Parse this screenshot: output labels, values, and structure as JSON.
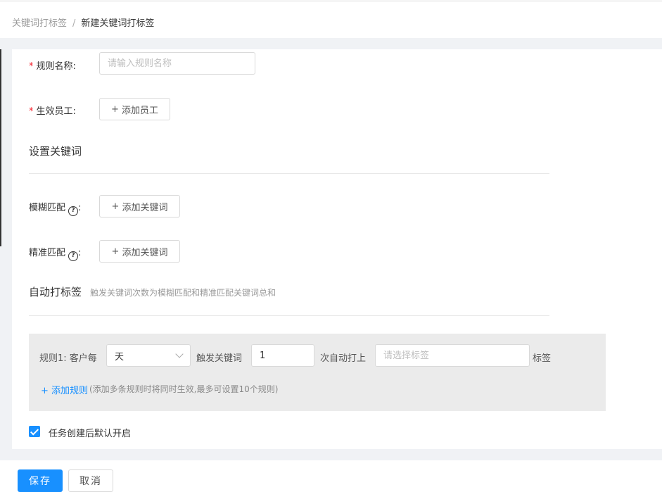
{
  "breadcrumb": {
    "parent": "关键词打标签",
    "separator": "/",
    "current": "新建关键词打标签"
  },
  "form": {
    "required_mark": "*",
    "rule_name": {
      "label": "规则名称:",
      "placeholder": "请输入规则名称",
      "value": ""
    },
    "employees": {
      "label": "生效员工:",
      "button": "添加员工"
    },
    "plus": "+"
  },
  "keywords_section": {
    "title": "设置关键词",
    "fuzzy": {
      "label": "模糊匹配",
      "colon": ":",
      "button": "添加关键词"
    },
    "exact": {
      "label": "精准匹配",
      "colon": ":",
      "button": "添加关键词"
    },
    "help_glyph": "?"
  },
  "auto_tag": {
    "title": "自动打标签",
    "note": "触发关键词次数为模糊匹配和精准匹配关键词总和",
    "rule": {
      "prefix": "规则1:",
      "per": "客户每",
      "period": "天",
      "trigger": "触发关键词",
      "count": "1",
      "auto_tag_text": "次自动打上",
      "tag_placeholder": "请选择标签",
      "suffix": "标签"
    },
    "add_rule": "+ 添加规则",
    "add_rule_note": "(添加多条规则时将同时生效,最多可设置10个规则)"
  },
  "default_enable": {
    "label": "任务创建后默认开启",
    "checked": true
  },
  "footer": {
    "save": "保存",
    "cancel": "取消"
  },
  "colors": {
    "primary": "#1890ff",
    "required": "#f5222d",
    "rule_bg": "#ebebeb"
  },
  "icons": {
    "help": "question-circle-icon",
    "check": "check-icon",
    "dropdown": "chevron-down-icon"
  }
}
